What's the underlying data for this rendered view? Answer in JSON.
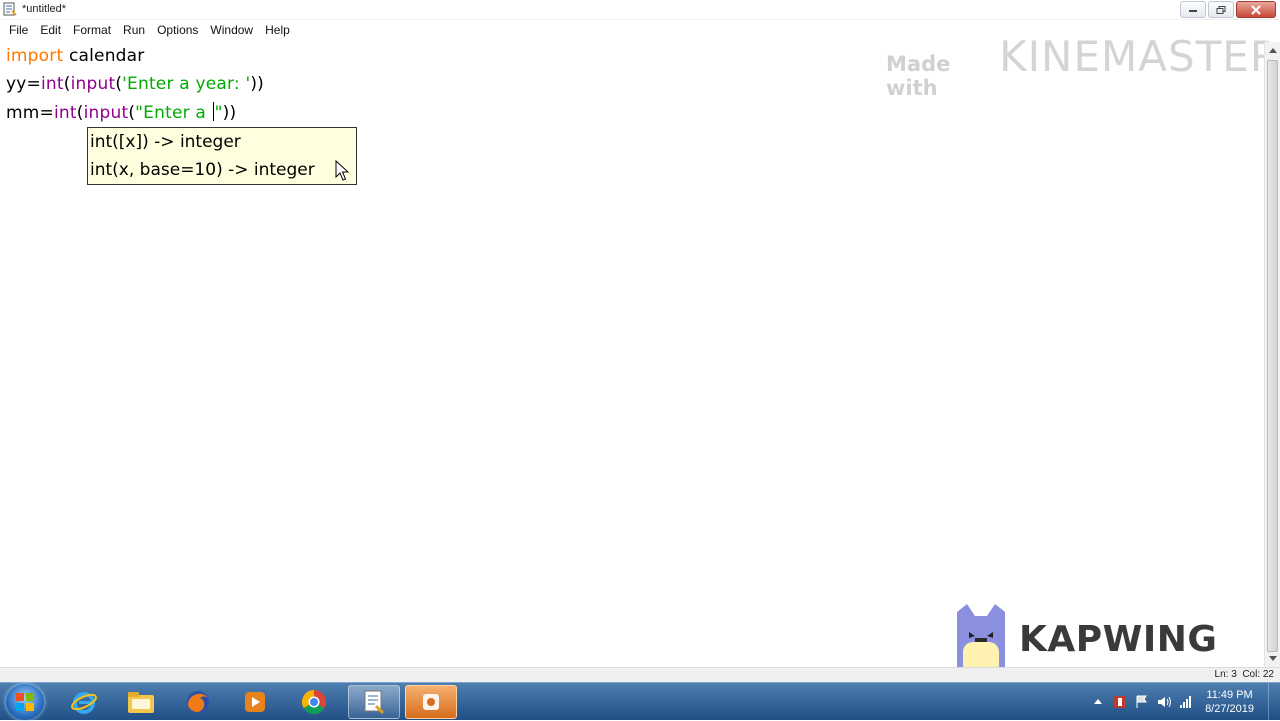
{
  "window": {
    "title": "*untitled*"
  },
  "menu": [
    "File",
    "Edit",
    "Format",
    "Run",
    "Options",
    "Window",
    "Help"
  ],
  "code": {
    "line1": {
      "keyword": "import",
      "rest": " calendar"
    },
    "line2": {
      "prefix": "yy=",
      "fn1": "int",
      "p1": "(",
      "fn2": "input",
      "p2": "(",
      "str": "'Enter a year: '",
      "close": "))"
    },
    "line3": {
      "prefix": "mm=",
      "fn1": "int",
      "p1": "(",
      "fn2": "input",
      "p2": "(",
      "str_open": "\"Enter a ",
      "str_close": "\"",
      "close": "))"
    }
  },
  "calltip": {
    "line1": "int([x]) -> integer",
    "line2": "int(x, base=10) -> integer"
  },
  "watermarks": {
    "made_with": "Made with",
    "kinemaster": "KINEMASTER",
    "kapwing": "KAPWING"
  },
  "status": {
    "position": "Ln: 3  Col: 22"
  },
  "clock": {
    "time": "11:49 PM",
    "date": "8/27/2019"
  },
  "taskbar_icons": [
    "ie-icon",
    "explorer-icon",
    "firefox-icon",
    "media-player-icon",
    "chrome-icon",
    "python-icon",
    "kinemaster-icon"
  ],
  "colors": {
    "keyword": "#ff7700",
    "builtin": "#900090",
    "string": "#00aa00",
    "calltip_bg": "#ffffe0"
  }
}
